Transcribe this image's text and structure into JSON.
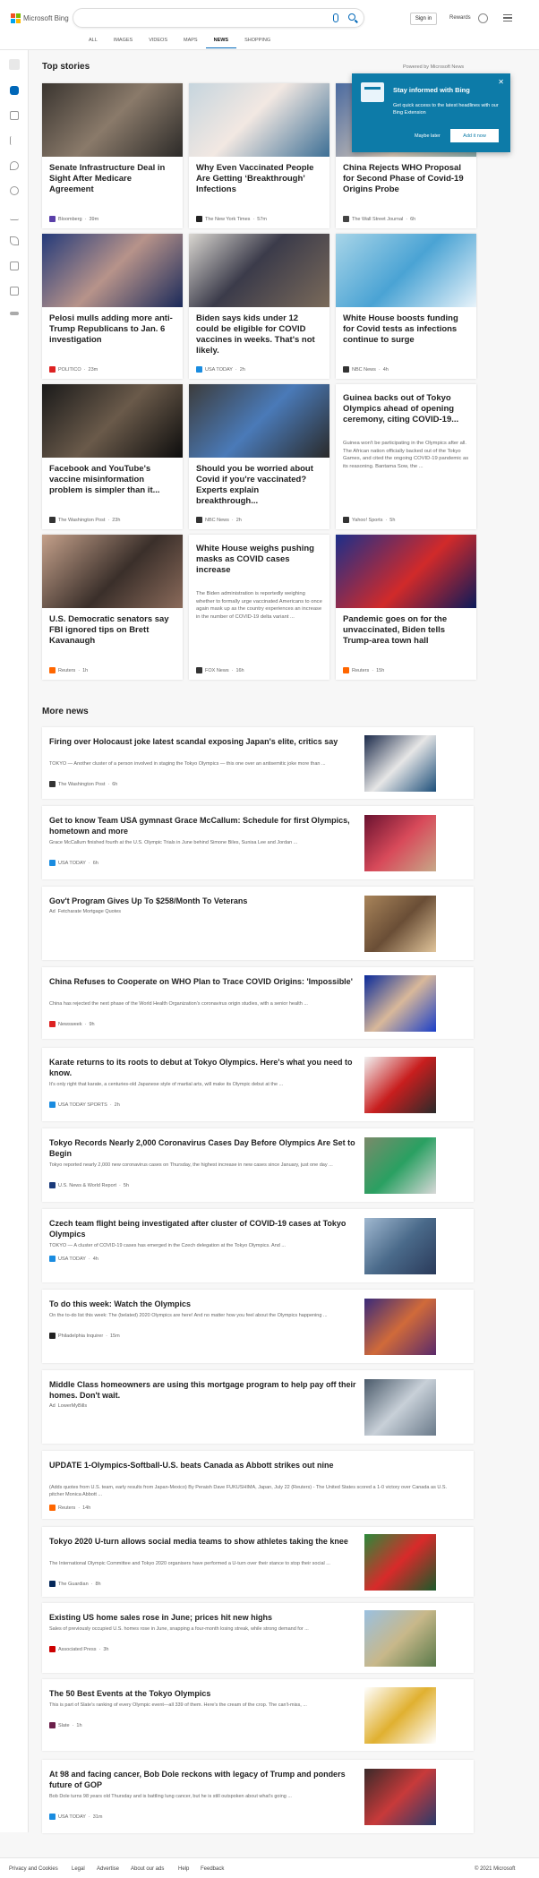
{
  "header": {
    "logo_text": "Microsoft Bing",
    "signin": "Sign in",
    "rewards": "Rewards",
    "tabs": [
      "ALL",
      "IMAGES",
      "VIDEOS",
      "MAPS",
      "NEWS",
      "SHOPPING"
    ],
    "active_tab": "NEWS"
  },
  "top": {
    "title": "Top stories",
    "powered": "Powered by Microsoft News"
  },
  "popup": {
    "title": "Stay informed with Bing",
    "body": "Get quick access to the latest headlines with our Bing Extension",
    "later": "Maybe later",
    "add": "Add it now"
  },
  "cards": [
    {
      "title": "Senate Infrastructure Deal in Sight After Medicare Agreement",
      "source": "Bloomberg",
      "time": "39m",
      "color": "#5a3fa8"
    },
    {
      "title": "Why Even Vaccinated People Are Getting ‘Breakthrough’ Infections",
      "source": "The New York Times",
      "time": "57m",
      "color": "#222"
    },
    {
      "title": "China Rejects WHO Proposal for Second Phase of Covid-19 Origins Probe",
      "source": "The Wall Street Journal",
      "time": "6h",
      "color": "#444"
    },
    {
      "title": "Pelosi mulls adding more anti-Trump Republicans to Jan. 6 investigation",
      "source": "POLITICO",
      "time": "23m",
      "color": "#d22"
    },
    {
      "title": "Biden says kids under 12 could be eligible for COVID vaccines in weeks. That's not likely.",
      "source": "USA TODAY",
      "time": "2h",
      "color": "#1a8ce0"
    },
    {
      "title": "White House boosts funding for Covid tests as infections continue to surge",
      "source": "NBC News",
      "time": "4h",
      "color": "#333"
    },
    {
      "title": "Facebook and YouTube's vaccine misinformation problem is simpler than it...",
      "source": "The Washington Post",
      "time": "23h",
      "color": "#333"
    },
    {
      "title": "Should you be worried about Covid if you're vaccinated? Experts explain breakthrough...",
      "source": "NBC News",
      "time": "2h",
      "color": "#333"
    },
    {
      "title": "Guinea backs out of Tokyo Olympics ahead of opening ceremony, citing COVID-19...",
      "source": "Yahoo! Sports",
      "time": "5h",
      "color": "#333",
      "body": "Guinea won't be participating in the Olympics after all. The African nation officially backed out of the Tokyo Games, and cited the ongoing COVID-19 pandemic as its reasoning.  Bantama Sow, the ..."
    },
    {
      "title": "U.S. Democratic senators say FBI ignored tips on Brett Kavanaugh",
      "source": "Reuters",
      "time": "1h",
      "color": "#f60"
    },
    {
      "title": "White House weighs pushing masks as COVID cases increase",
      "source": "FOX News",
      "time": "16h",
      "color": "#333",
      "body": "The Biden administration is reportedly weighing whether to formally urge vaccinated Americans to once again mask up as the country experiences an increase in the number of COVID-19 delta variant ..."
    },
    {
      "title": "Pandemic goes on for the unvaccinated, Biden tells Trump-area town hall",
      "source": "Reuters",
      "time": "15h",
      "color": "#f60"
    }
  ],
  "more": {
    "title": "More news",
    "items": [
      {
        "title": "Firing over Holocaust joke latest scandal exposing Japan's elite, critics say",
        "body": "TOKYO — Another cluster of a person involved in staging the Tokyo Olympics — this one over an antisemitic joke more than ...",
        "source": "The Washington Post",
        "time": "6h",
        "color": "#333"
      },
      {
        "title": "Get to know Team USA gymnast Grace McCallum: Schedule for first Olympics, hometown and more",
        "body": "Grace McCallum finished fourth at the U.S. Olympic Trials in June behind Simone Biles, Sunisa Lee and Jordan ...",
        "source": "USA TODAY",
        "time": "6h",
        "color": "#1a8ce0"
      },
      {
        "title": "Gov't Program Gives Up To $258/Month To Veterans",
        "body": "",
        "source": "Fetcharate Mortgage Quotes",
        "time": "",
        "ad": "Ad",
        "color": "#999"
      },
      {
        "title": "China Refuses to Cooperate on WHO Plan to Trace COVID Origins: 'Impossible'",
        "body": "China has rejected the next phase of the World Health Organization's coronavirus origin studies, with a senior health ...",
        "source": "Newsweek",
        "time": "9h",
        "color": "#d22"
      },
      {
        "title": "Karate returns to its roots to debut at Tokyo Olympics. Here's what you need to know.",
        "body": "It's only right that karate, a centuries-old Japanese style of martial arts, will make its Olympic debut at the ...",
        "source": "USA TODAY SPORTS",
        "time": "2h",
        "color": "#1a8ce0"
      },
      {
        "title": "Tokyo Records Nearly 2,000 Coronavirus Cases Day Before Olympics Are Set to Begin",
        "body": "Tokyo reported nearly 2,000 new coronavirus cases on Thursday, the highest increase in new cases since January, just one day ...",
        "source": "U.S. News & World Report",
        "time": "5h",
        "color": "#1a3a7a"
      },
      {
        "title": "Czech team flight being investigated after cluster of COVID-19 cases at Tokyo Olympics",
        "body": "TOKYO — A cluster of COVID-19 cases has emerged in the Czech delegation at the Tokyo Olympics. And ...",
        "source": "USA TODAY",
        "time": "4h",
        "color": "#1a8ce0"
      },
      {
        "title": "To do this week: Watch the Olympics",
        "body": "On the to-do list this week: The (belated) 2020 Olympics are here! And no matter how you feel about the Olympics happening ...",
        "source": "Philadelphia Inquirer",
        "time": "15m",
        "color": "#222"
      },
      {
        "title": "Middle Class homeowners are using this mortgage program to help pay off their homes. Don't wait.",
        "body": "",
        "source": "LowerMyBills",
        "time": "",
        "ad": "Ad",
        "color": "#999"
      },
      {
        "title": "UPDATE 1-Olympics-Softball-U.S. beats Canada as Abbott strikes out nine",
        "body": "(Adds quotes from U.S. team, early results from Japan-Mexico) By Peraish Dave FUKUSHIMA, Japan, July 22 (Reuters) - The United States scored a 1-0 victory over Canada as U.S. pitcher Monica Abbott ...",
        "source": "Reuters",
        "time": "14h",
        "color": "#f60"
      },
      {
        "title": "Tokyo 2020 U-turn allows social media teams to show athletes taking the knee",
        "body": "The International Olympic Committee and Tokyo 2020 organisers have performed a U-turn over their stance to stop their social ...",
        "source": "The Guardian",
        "time": "8h",
        "color": "#05285a"
      },
      {
        "title": "Existing US home sales rose in June; prices hit new highs",
        "body": "Sales of previously occupied U.S. homes rose in June, snapping a four-month losing streak, while strong demand for ...",
        "source": "Associated Press",
        "time": "3h",
        "color": "#c00"
      },
      {
        "title": "The 50 Best Events at the Tokyo Olympics",
        "body": "This is part of Slate's ranking of every Olympic event—all 339 of them. Here's the cream of the crop. The can't-miss, ...",
        "source": "Slate",
        "time": "1h",
        "color": "#6b1f4a"
      },
      {
        "title": "At 98 and facing cancer, Bob Dole reckons with legacy of Trump and ponders future of GOP",
        "body": "Bob Dole turns 98 years old Thursday and is battling lung cancer, but he is still outspoken about what's going ...",
        "source": "USA TODAY",
        "time": "31m",
        "color": "#1a8ce0"
      }
    ]
  },
  "footer": {
    "links": [
      "Privacy and Cookies",
      "Legal",
      "Advertise",
      "About our ads",
      "Help",
      "Feedback"
    ],
    "copyright": "© 2021 Microsoft"
  },
  "colors": {
    "accent": "#0067b8",
    "popup": "#0d7ba8"
  }
}
